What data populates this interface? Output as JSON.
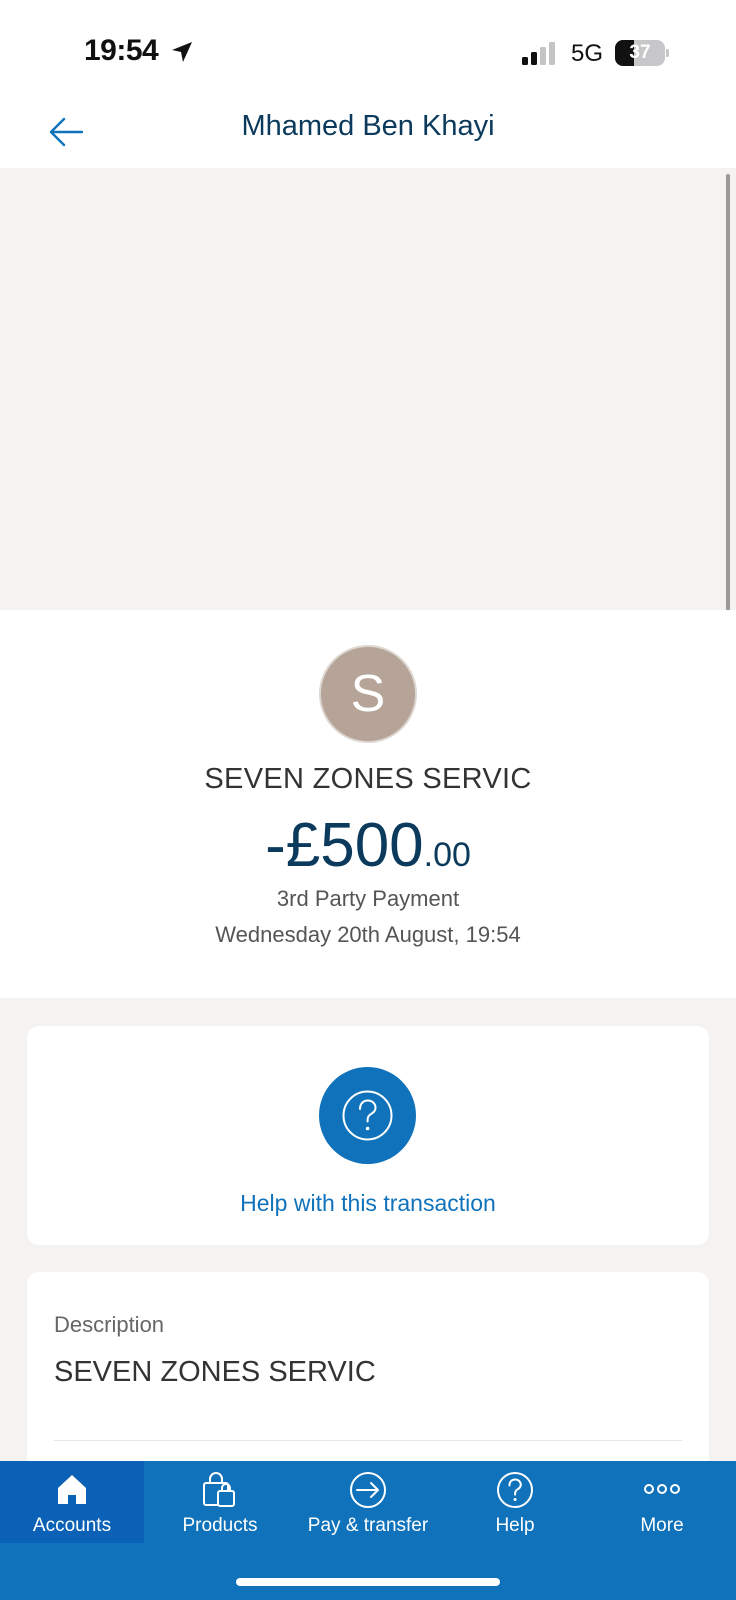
{
  "status_bar": {
    "time": "19:54",
    "network": "5G",
    "battery": "37"
  },
  "header": {
    "title": "Mhamed Ben Khayi"
  },
  "transaction": {
    "avatar_letter": "S",
    "merchant": "SEVEN ZONES SERVIC",
    "amount_main": "-£500",
    "amount_decimal": ".00",
    "type": "3rd Party Payment",
    "date": "Wednesday 20th August, 19:54"
  },
  "help": {
    "label": "Help with this transaction"
  },
  "details": {
    "description_label": "Description",
    "description_value": "SEVEN ZONES SERVIC"
  },
  "tab_bar": {
    "tabs": [
      {
        "label": "Accounts",
        "icon": "home-icon",
        "active": true
      },
      {
        "label": "Products",
        "icon": "shopping-bag-icon",
        "active": false
      },
      {
        "label": "Pay & transfer",
        "icon": "transfer-icon",
        "active": false
      },
      {
        "label": "Help",
        "icon": "help-icon",
        "active": false
      },
      {
        "label": "More",
        "icon": "more-icon",
        "active": false
      }
    ]
  },
  "colors": {
    "brand_blue": "#0f72ba",
    "active_tab": "#0a61b6",
    "title_navy": "#0b3a5c",
    "avatar_bg": "#b5a497",
    "page_bg": "#f4f3f1"
  }
}
